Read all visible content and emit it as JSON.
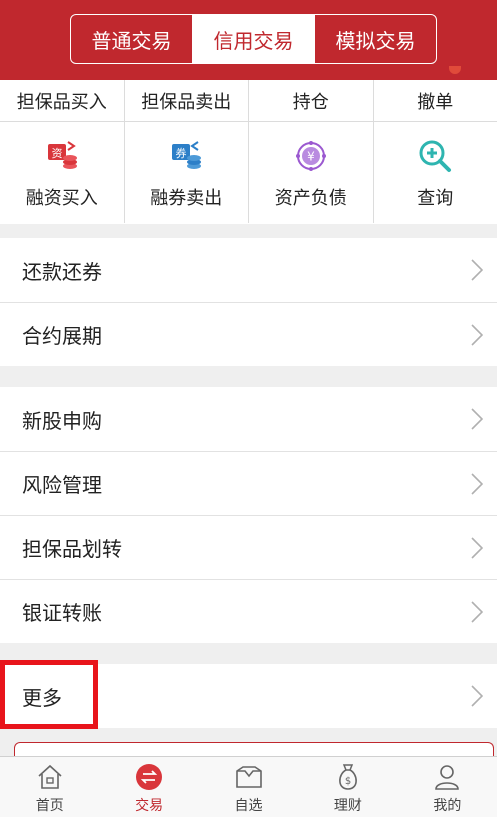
{
  "header": {
    "tabs": [
      {
        "label": "普通交易",
        "active": false
      },
      {
        "label": "信用交易",
        "active": true
      },
      {
        "label": "模拟交易",
        "active": false
      }
    ]
  },
  "quick_actions": {
    "row1": [
      "担保品买入",
      "担保品卖出",
      "持仓",
      "撤单"
    ],
    "row2": [
      {
        "label": "融资买入",
        "icon": "financing-buy-icon"
      },
      {
        "label": "融券卖出",
        "icon": "securities-sell-icon"
      },
      {
        "label": "资产负债",
        "icon": "yen-assets-icon"
      },
      {
        "label": "查询",
        "icon": "search-plus-icon"
      }
    ]
  },
  "menu": {
    "group1": [
      "还款还券",
      "合约展期"
    ],
    "group2": [
      "新股申购",
      "风险管理",
      "担保品划转",
      "银证转账"
    ],
    "group3": [
      "更多"
    ]
  },
  "tabbar": {
    "items": [
      {
        "label": "首页",
        "icon": "home-icon",
        "active": false
      },
      {
        "label": "交易",
        "icon": "trade-icon",
        "active": true
      },
      {
        "label": "自选",
        "icon": "watchlist-icon",
        "active": false
      },
      {
        "label": "理财",
        "icon": "money-bag-icon",
        "active": false
      },
      {
        "label": "我的",
        "icon": "user-icon",
        "active": false
      }
    ]
  },
  "colors": {
    "brand": "#c0282e",
    "highlight": "#e8141b"
  }
}
